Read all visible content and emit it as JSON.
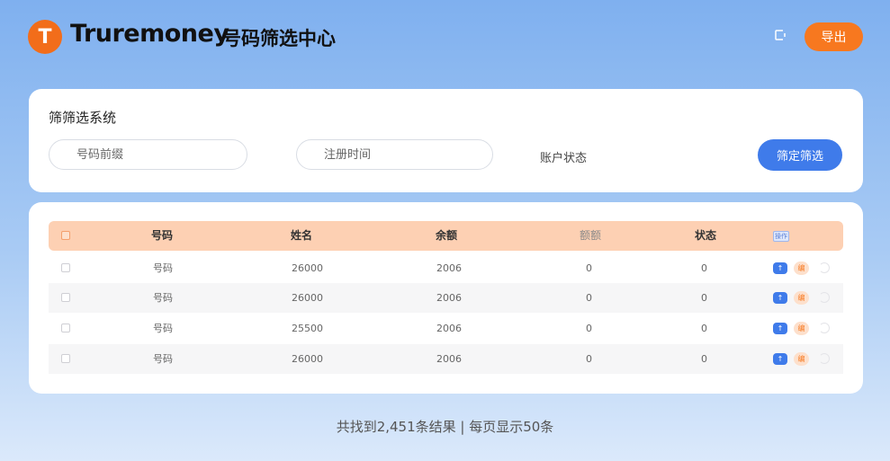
{
  "header": {
    "logo_letter": "T",
    "brand": "Truremoney",
    "subtitle": "号码筛选中心",
    "icon": "exit-icon",
    "export_label": "导出"
  },
  "filter": {
    "title": "筛筛选系统",
    "prefix_placeholder": "号码前缀",
    "date_placeholder": "注册时间",
    "status_label": "账户状态",
    "confirm_label": "筛定筛选"
  },
  "table": {
    "headers": [
      "号码",
      "姓名",
      "余额",
      "额额",
      "状态",
      "操作"
    ],
    "rows": [
      {
        "number": "号码",
        "name": "26000",
        "balance": "2006",
        "amount": "0",
        "status": "0",
        "action1": "↑",
        "action2": "编"
      },
      {
        "number": "号码",
        "name": "26000",
        "balance": "2006",
        "amount": "0",
        "status": "0",
        "action1": "↑",
        "action2": "编"
      },
      {
        "number": "号码",
        "name": "25500",
        "balance": "2006",
        "amount": "0",
        "status": "0",
        "action1": "↑",
        "action2": "编"
      },
      {
        "number": "号码",
        "name": "26000",
        "balance": "2006",
        "amount": "0",
        "status": "0",
        "action1": "↑",
        "action2": "编"
      }
    ]
  },
  "footer": {
    "summary": "共找到2,451条结果 | 每页显示50条"
  },
  "colors": {
    "accent_orange": "#f7781f",
    "accent_blue": "#3f7bea",
    "header_row": "#fdd0b3"
  }
}
